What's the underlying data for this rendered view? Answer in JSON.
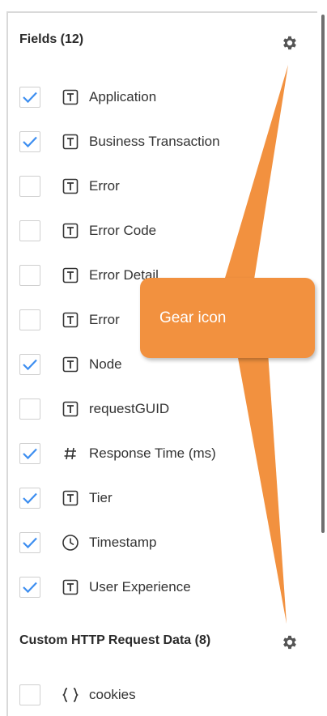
{
  "sections": [
    {
      "title": "Fields (12)",
      "fields": [
        {
          "label": "Application",
          "type": "text",
          "checked": true
        },
        {
          "label": "Business Transaction",
          "type": "text",
          "checked": true
        },
        {
          "label": "Error",
          "type": "text",
          "checked": false
        },
        {
          "label": "Error Code",
          "type": "text",
          "checked": false
        },
        {
          "label": "Error Detail",
          "type": "text",
          "checked": false
        },
        {
          "label": "Error",
          "type": "text",
          "checked": false
        },
        {
          "label": "Node",
          "type": "text",
          "checked": true
        },
        {
          "label": "requestGUID",
          "type": "text",
          "checked": false
        },
        {
          "label": "Response Time (ms)",
          "type": "number",
          "checked": true
        },
        {
          "label": "Tier",
          "type": "text",
          "checked": true
        },
        {
          "label": "Timestamp",
          "type": "time",
          "checked": true
        },
        {
          "label": "User Experience",
          "type": "text",
          "checked": true
        }
      ]
    },
    {
      "title": "Custom HTTP Request Data (8)",
      "fields": [
        {
          "label": "cookies",
          "type": "object",
          "checked": false
        }
      ]
    }
  ],
  "callout": {
    "text": "Gear icon"
  },
  "icons": {
    "gear": "gear-icon",
    "text": "text-type-icon",
    "number": "hash-icon",
    "time": "clock-icon",
    "object": "braces-icon"
  },
  "colors": {
    "check": "#3d8ef0",
    "callout": "#f2913f",
    "gear": "#555555"
  }
}
